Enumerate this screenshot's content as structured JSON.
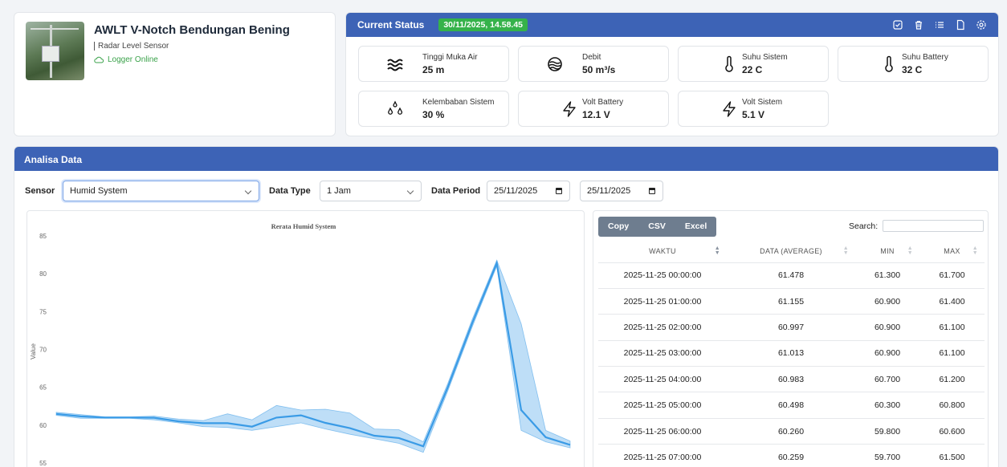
{
  "logger": {
    "title": "AWLT V-Notch Bendungan Bening",
    "sensor_type": "Radar Level Sensor",
    "status": "Logger Online"
  },
  "status": {
    "title": "Current Status",
    "timestamp": "30/11/2025, 14.58.45",
    "metrics": [
      {
        "label": "Tinggi Muka Air",
        "value": "25 m",
        "icon": "water-waves-icon"
      },
      {
        "label": "Debit",
        "value": "50 m³/s",
        "icon": "water-flow-icon"
      },
      {
        "label": "Suhu Sistem",
        "value": "22 C",
        "icon": "thermometer-icon"
      },
      {
        "label": "Suhu Battery",
        "value": "32 C",
        "icon": "thermometer-icon"
      },
      {
        "label": "Kelembaban Sistem",
        "value": "30 %",
        "icon": "droplets-icon"
      },
      {
        "label": "Volt Battery",
        "value": "12.1 V",
        "icon": "lightning-icon"
      },
      {
        "label": "Volt Sistem",
        "value": "5.1 V",
        "icon": "lightning-icon"
      }
    ]
  },
  "analisa": {
    "title": "Analisa Data",
    "sensor_label": "Sensor",
    "sensor_value": "Humid System",
    "data_type_label": "Data Type",
    "data_type_value": "1 Jam",
    "period_label": "Data Period",
    "period_start": "25/11/2025",
    "period_end": "25/11/2025"
  },
  "table": {
    "buttons": [
      "Copy",
      "CSV",
      "Excel"
    ],
    "search_label": "Search:",
    "headers": [
      "WAKTU",
      "DATA (AVERAGE)",
      "MIN",
      "MAX"
    ],
    "rows": [
      [
        "2025-11-25 00:00:00",
        "61.478",
        "61.300",
        "61.700"
      ],
      [
        "2025-11-25 01:00:00",
        "61.155",
        "60.900",
        "61.400"
      ],
      [
        "2025-11-25 02:00:00",
        "60.997",
        "60.900",
        "61.100"
      ],
      [
        "2025-11-25 03:00:00",
        "61.013",
        "60.900",
        "61.100"
      ],
      [
        "2025-11-25 04:00:00",
        "60.983",
        "60.700",
        "61.200"
      ],
      [
        "2025-11-25 05:00:00",
        "60.498",
        "60.300",
        "60.800"
      ],
      [
        "2025-11-25 06:00:00",
        "60.260",
        "59.800",
        "60.600"
      ],
      [
        "2025-11-25 07:00:00",
        "60.259",
        "59.700",
        "61.500"
      ]
    ]
  },
  "chart_data": {
    "type": "area",
    "title": "Rerata Humid System",
    "ylabel": "Value",
    "ylim": [
      55,
      85
    ],
    "yticks": [
      55,
      60,
      65,
      70,
      75,
      80,
      85
    ],
    "grid": false,
    "color": "#3a9be6",
    "series": [
      {
        "avg": [
          61.478,
          61.155,
          60.997,
          61.013,
          60.983,
          60.498,
          60.26,
          60.259,
          59.8,
          61.0,
          61.3,
          60.3,
          59.6,
          58.6,
          58.3,
          57.2,
          65.0,
          73.5,
          81.4,
          62.0,
          58.4,
          57.4
        ],
        "min": [
          61.3,
          60.9,
          60.9,
          60.9,
          60.7,
          60.3,
          59.8,
          59.7,
          59.3,
          59.8,
          60.3,
          59.5,
          58.8,
          58.2,
          57.6,
          56.4,
          64.5,
          73.0,
          81.0,
          59.3,
          57.8,
          57.0
        ],
        "max": [
          61.7,
          61.4,
          61.1,
          61.1,
          61.2,
          60.8,
          60.6,
          61.5,
          60.7,
          62.6,
          62.0,
          62.1,
          61.6,
          59.5,
          59.4,
          57.8,
          65.5,
          74.0,
          81.8,
          73.4,
          59.3,
          57.9
        ]
      }
    ]
  }
}
